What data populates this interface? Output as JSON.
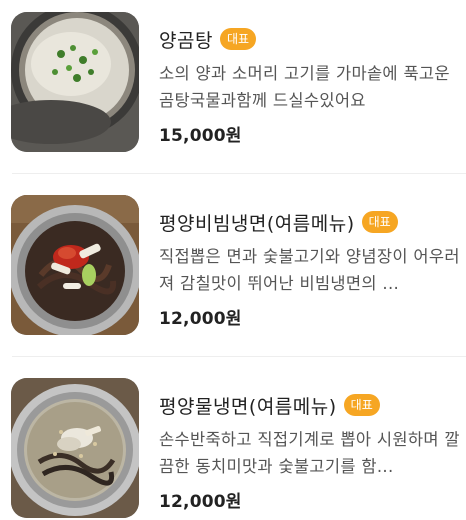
{
  "menu": {
    "items": [
      {
        "name": "양곰탕",
        "badge": "대표",
        "description": "소의 양과 소머리 고기를 가마솥에 푹고운 곰탕국물과함께 드실수있어요",
        "price": "15,000원",
        "image_icon": "beef-soup-photo"
      },
      {
        "name": "평양비빔냉면(여름메뉴)",
        "badge": "대표",
        "description": "직접뽑은 면과 숯불고기와 양념장이 어우러져 감칠맛이 뛰어난 비빔냉면의 ...",
        "price": "12,000원",
        "image_icon": "spicy-cold-noodle-photo"
      },
      {
        "name": "평양물냉면(여름메뉴)",
        "badge": "대표",
        "description": "손수반죽하고 직접기계로 뽑아 시원하며 깔끔한 동치미맛과 숯불고기를 함...",
        "price": "12,000원",
        "image_icon": "cold-noodle-broth-photo"
      }
    ]
  },
  "colors": {
    "badge_bg": "#f6a623",
    "text_primary": "#222222",
    "text_secondary": "#555555",
    "divider": "#eeeeee"
  }
}
